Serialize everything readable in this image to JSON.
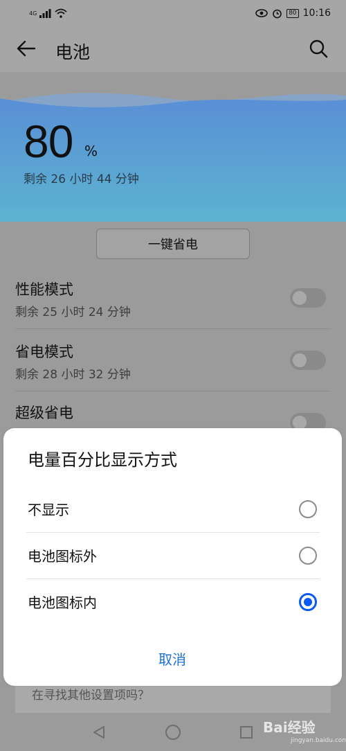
{
  "status_bar": {
    "network": "4G",
    "time": "10:16",
    "battery_level": "80"
  },
  "app_bar": {
    "title": "电池",
    "back_icon": "arrow-left-icon",
    "search_icon": "search-icon"
  },
  "battery": {
    "percent": "80",
    "percent_sign": "%",
    "remaining": "剩余 26 小时 44 分钟"
  },
  "one_key_save": {
    "label": "一键省电"
  },
  "modes": [
    {
      "title": "性能模式",
      "subtitle": "剩余 25 小时 24 分钟",
      "enabled": false
    },
    {
      "title": "省电模式",
      "subtitle": "剩余 28 小时 32 分钟",
      "enabled": false
    },
    {
      "title": "超级省电",
      "subtitle": "",
      "enabled": false
    }
  ],
  "find_more": {
    "label": "在寻找其他设置项吗？"
  },
  "nav": {
    "back_icon": "triangle-back-icon",
    "home_icon": "circle-home-icon",
    "recents_icon": "square-recents-icon"
  },
  "watermark": {
    "brand": "Bai经验",
    "site": "jingyan.baidu.com"
  },
  "dialog": {
    "title": "电量百分比显示方式",
    "options": [
      {
        "label": "不显示",
        "selected": false
      },
      {
        "label": "电池图标外",
        "selected": false
      },
      {
        "label": "电池图标内",
        "selected": true
      }
    ],
    "cancel": "取消"
  },
  "colors": {
    "accent": "#0a59f7",
    "link": "#1a6fd8",
    "wave_top": "#5a8fd6",
    "wave_bottom": "#5cb3d0"
  }
}
